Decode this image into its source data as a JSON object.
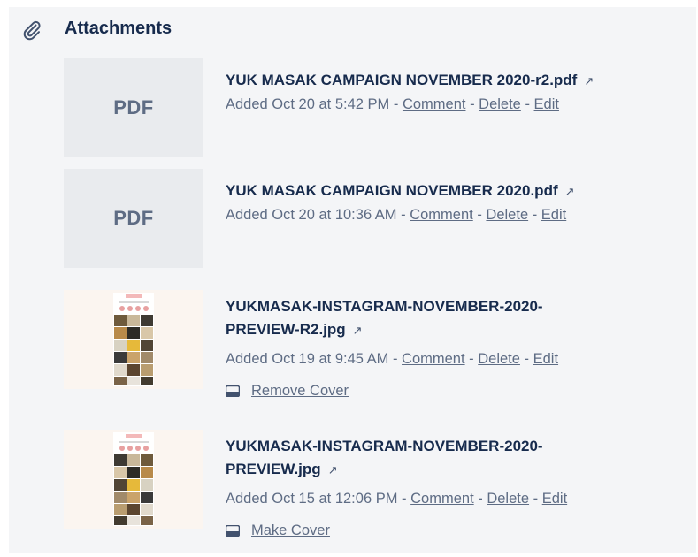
{
  "section": {
    "title": "Attachments",
    "icon": "paperclip-icon"
  },
  "attachments": [
    {
      "thumb_label": "PDF",
      "name": "YUK MASAK CAMPAIGN NOVEMBER 2020-r2.pdf",
      "name_line2": "",
      "added": "Added Oct 20 at 5:42 PM",
      "comment": "Comment",
      "delete": "Delete",
      "edit": "Edit",
      "cover_action": ""
    },
    {
      "thumb_label": "PDF",
      "name": "YUK MASAK CAMPAIGN NOVEMBER 2020.pdf",
      "name_line2": "",
      "added": "Added Oct 20 at 10:36 AM",
      "comment": "Comment",
      "delete": "Delete",
      "edit": "Edit",
      "cover_action": ""
    },
    {
      "thumb_label": "",
      "name": "YUKMASAK-INSTAGRAM-NOVEMBER-2020-",
      "name_line2": "PREVIEW-R2.jpg",
      "added": "Added Oct 19 at 9:45 AM",
      "comment": "Comment",
      "delete": "Delete",
      "edit": "Edit",
      "cover_action": "Remove Cover"
    },
    {
      "thumb_label": "",
      "name": "YUKMASAK-INSTAGRAM-NOVEMBER-2020-",
      "name_line2": "PREVIEW.jpg",
      "added": "Added Oct 15 at 12:06 PM",
      "comment": "Comment",
      "delete": "Delete",
      "edit": "Edit",
      "cover_action": "Make Cover"
    }
  ],
  "separator": " - ",
  "open_arrow": "↗",
  "colors": {
    "title": "#172b4d",
    "meta": "#5e6c84",
    "panel_bg": "#f4f5f7",
    "thumb_bg": "#e9ebee"
  }
}
